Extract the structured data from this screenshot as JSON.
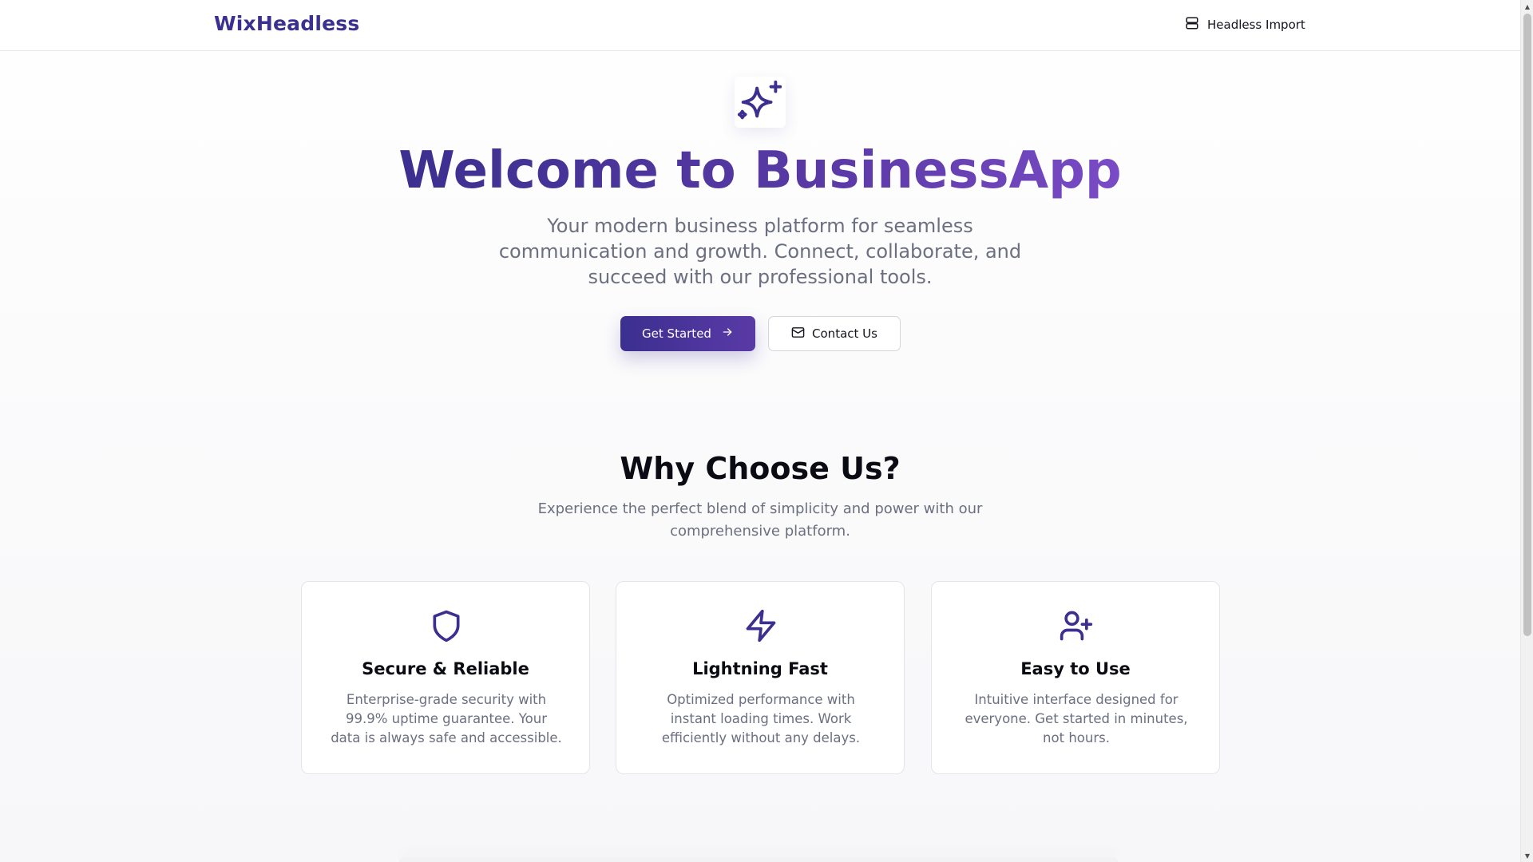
{
  "header": {
    "brand": "WixHeadless",
    "nav_label": "Headless Import",
    "nav_icon": "server-icon"
  },
  "hero": {
    "icon": "sparkles-icon",
    "title": "Welcome to BusinessApp",
    "subtitle": "Your modern business platform for seamless communication and growth. Connect, collaborate, and succeed with our professional tools.",
    "primary_button": "Get Started",
    "primary_button_icon": "arrow-right-icon",
    "secondary_button": "Contact Us",
    "secondary_button_icon": "mail-icon"
  },
  "features": {
    "title": "Why Choose Us?",
    "subtitle": "Experience the perfect blend of simplicity and power with our comprehensive platform.",
    "items": [
      {
        "icon": "shield-icon",
        "title": "Secure & Reliable",
        "text": "Enterprise-grade security with 99.9% uptime guarantee. Your data is always safe and accessible."
      },
      {
        "icon": "zap-icon",
        "title": "Lightning Fast",
        "text": "Optimized performance with instant loading times. Work efficiently without any delays."
      },
      {
        "icon": "user-plus-icon",
        "title": "Easy to Use",
        "text": "Intuitive interface designed for everyone. Get started in minutes, not hours."
      }
    ]
  },
  "colors": {
    "brand": "#3b2f8f",
    "brand_light": "#7a4bc6",
    "muted_text": "#6b6f80",
    "border": "#e4e4ea"
  }
}
